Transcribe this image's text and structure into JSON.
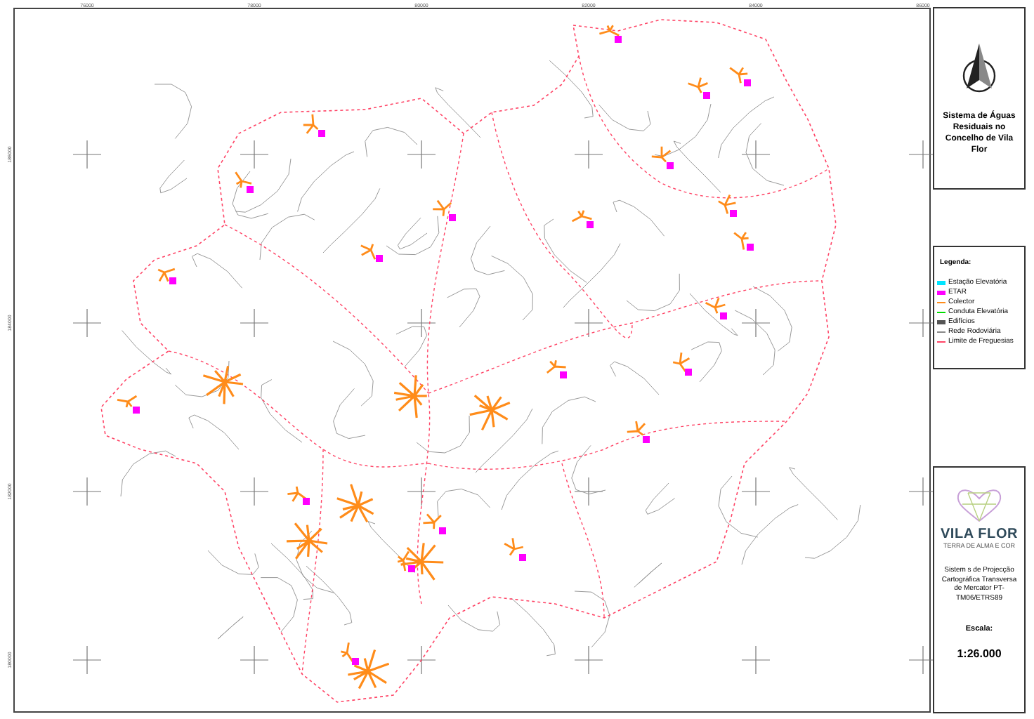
{
  "map": {
    "x_ticks": [
      "76000",
      "78000",
      "80000",
      "82000",
      "84000",
      "86000"
    ],
    "y_ticks": [
      "186000",
      "184000",
      "182000",
      "180000"
    ]
  },
  "title_panel": {
    "title": "Sistema de Águas Residuais no Concelho de Vila Flor"
  },
  "legend": {
    "title": "Legenda:",
    "items": [
      {
        "kind": "box",
        "color": "#00e5ff",
        "label": "Estação Elevatória"
      },
      {
        "kind": "box",
        "color": "#ff00ff",
        "label": "ETAR"
      },
      {
        "kind": "line",
        "color": "#ff8c1a",
        "label": "Colector"
      },
      {
        "kind": "line",
        "color": "#00dd00",
        "label": "Conduta Elevatória"
      },
      {
        "kind": "box",
        "color": "#555555",
        "label": "Edifícios"
      },
      {
        "kind": "line",
        "color": "#888888",
        "label": "Rede Rodoviária"
      },
      {
        "kind": "dashed",
        "color": "#ff4466",
        "label": "Limite de Freguesias"
      }
    ]
  },
  "info_panel": {
    "logo_name": "VILA FLOR",
    "logo_tagline": "TERRA DE ALMA E COR",
    "projection": "Sistem s de Projecção Cartográfica Transversa de Mercator PT-TM06/ETRS89",
    "scale_label": "Escala:",
    "scale": "1:26.000"
  }
}
